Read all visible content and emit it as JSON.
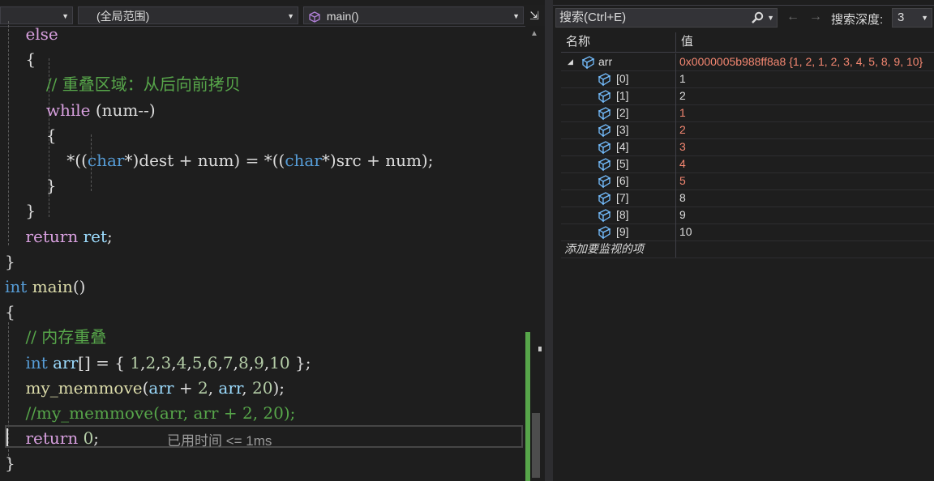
{
  "editor": {
    "nav": {
      "scope": "(全局范围)",
      "function": "main()"
    },
    "code_lines": [
      {
        "id": "l0",
        "segments": [
          [
            "    ",
            ""
          ],
          [
            "else",
            "ctl"
          ]
        ]
      },
      {
        "id": "l1",
        "segments": [
          [
            "    {",
            ""
          ]
        ]
      },
      {
        "id": "l2",
        "segments": [
          [
            "        ",
            ""
          ],
          [
            "// 重叠区域：从后向前拷贝",
            "cm"
          ]
        ]
      },
      {
        "id": "l3",
        "segments": [
          [
            "        ",
            ""
          ],
          [
            "while",
            "ctl"
          ],
          [
            " (num--)",
            ""
          ]
        ]
      },
      {
        "id": "l4",
        "segments": [
          [
            "        {",
            ""
          ]
        ]
      },
      {
        "id": "l5",
        "segments": [
          [
            "            *((",
            ""
          ],
          [
            "char",
            "kw"
          ],
          [
            "*)dest + num) = *((",
            ""
          ],
          [
            "char",
            "kw"
          ],
          [
            "*)src + num);",
            ""
          ]
        ]
      },
      {
        "id": "l6",
        "segments": [
          [
            "        }",
            ""
          ]
        ]
      },
      {
        "id": "l7",
        "segments": [
          [
            "    }",
            ""
          ]
        ]
      },
      {
        "id": "l8",
        "segments": [
          [
            "    ",
            ""
          ],
          [
            "return",
            "ctl"
          ],
          [
            " ",
            ""
          ],
          [
            "ret",
            "var"
          ],
          [
            ";",
            ""
          ]
        ]
      },
      {
        "id": "l9",
        "segments": [
          [
            "}",
            ""
          ]
        ]
      },
      {
        "id": "l10",
        "segments": [
          [
            "int",
            "kw"
          ],
          [
            " ",
            ""
          ],
          [
            "main",
            "fn"
          ],
          [
            "()",
            ""
          ]
        ]
      },
      {
        "id": "l11",
        "segments": [
          [
            "{",
            ""
          ]
        ]
      },
      {
        "id": "l12",
        "segments": [
          [
            "    ",
            ""
          ],
          [
            "// 内存重叠",
            "cm"
          ]
        ]
      },
      {
        "id": "l13",
        "segments": [
          [
            "    ",
            ""
          ],
          [
            "int",
            "kw"
          ],
          [
            " ",
            ""
          ],
          [
            "arr",
            "var"
          ],
          [
            "[] = { ",
            ""
          ],
          [
            "1",
            "num"
          ],
          [
            ",",
            ""
          ],
          [
            "2",
            "num"
          ],
          [
            ",",
            ""
          ],
          [
            "3",
            "num"
          ],
          [
            ",",
            ""
          ],
          [
            "4",
            "num"
          ],
          [
            ",",
            ""
          ],
          [
            "5",
            "num"
          ],
          [
            ",",
            ""
          ],
          [
            "6",
            "num"
          ],
          [
            ",",
            ""
          ],
          [
            "7",
            "num"
          ],
          [
            ",",
            ""
          ],
          [
            "8",
            "num"
          ],
          [
            ",",
            ""
          ],
          [
            "9",
            "num"
          ],
          [
            ",",
            ""
          ],
          [
            "10",
            "num"
          ],
          [
            " };",
            ""
          ]
        ]
      },
      {
        "id": "l14",
        "segments": [
          [
            "    ",
            ""
          ],
          [
            "my_memmove",
            "fn"
          ],
          [
            "(",
            ""
          ],
          [
            "arr",
            "var"
          ],
          [
            " + ",
            ""
          ],
          [
            "2",
            "num"
          ],
          [
            ", ",
            ""
          ],
          [
            "arr",
            "var"
          ],
          [
            ", ",
            ""
          ],
          [
            "20",
            "num"
          ],
          [
            ");",
            ""
          ]
        ]
      },
      {
        "id": "l15",
        "segments": [
          [
            "    ",
            ""
          ],
          [
            "//my_memmove(arr, arr + 2, 20);",
            "cm"
          ]
        ]
      },
      {
        "id": "l16",
        "segments": [
          [
            "    ",
            ""
          ],
          [
            "return",
            "ctl"
          ],
          [
            " ",
            ""
          ],
          [
            "0",
            "num"
          ],
          [
            ";",
            ""
          ]
        ]
      },
      {
        "id": "l17",
        "segments": [
          [
            "}",
            ""
          ]
        ]
      }
    ],
    "perf_tip": "已用时间 <= 1ms"
  },
  "watch": {
    "search_placeholder": "搜索(Ctrl+E)",
    "depth_label": "搜索深度:",
    "depth_value": "3",
    "columns": {
      "name": "名称",
      "value": "值"
    },
    "root": {
      "name": "arr",
      "value": "0x0000005b988ff8a8 {1, 2, 1, 2, 3, 4, 5, 8, 9, 10}"
    },
    "items": [
      {
        "name": "[0]",
        "value": "1",
        "changed": false
      },
      {
        "name": "[1]",
        "value": "2",
        "changed": false
      },
      {
        "name": "[2]",
        "value": "1",
        "changed": true
      },
      {
        "name": "[3]",
        "value": "2",
        "changed": true
      },
      {
        "name": "[4]",
        "value": "3",
        "changed": true
      },
      {
        "name": "[5]",
        "value": "4",
        "changed": true
      },
      {
        "name": "[6]",
        "value": "5",
        "changed": true
      },
      {
        "name": "[7]",
        "value": "8",
        "changed": false
      },
      {
        "name": "[8]",
        "value": "9",
        "changed": false
      },
      {
        "name": "[9]",
        "value": "10",
        "changed": false
      }
    ],
    "add_item_label": "添加要监视的项"
  },
  "colors": {
    "changed_value": "#f48771",
    "keyword": "#569cd6",
    "comment": "#57a64a",
    "control": "#d8a0df"
  }
}
